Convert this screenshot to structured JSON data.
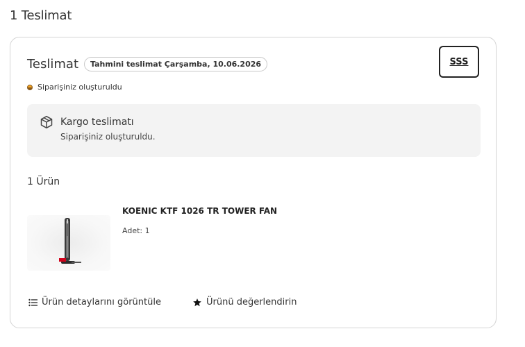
{
  "page": {
    "heading": "1 Teslimat"
  },
  "delivery": {
    "title": "Teslimat",
    "eta_badge": "Tahmini teslimat Çarşamba, 10.06.2026",
    "faq_label": "SSS",
    "status_text": "Siparişiniz oluşturuldu",
    "status_color": "#f5a623"
  },
  "shipping": {
    "icon": "package-icon",
    "title": "Kargo teslimatı",
    "subtitle": "Siparişiniz oluşturuldu."
  },
  "items": {
    "count_label": "1 Ürün",
    "products": [
      {
        "name": "KOENIC KTF 1026 TR TOWER FAN",
        "quantity": "Adet: 1"
      }
    ]
  },
  "actions": {
    "details_label": "Ürün detaylarını görüntüle",
    "details_icon": "list-icon",
    "rate_label": "Ürünü değerlendirin",
    "rate_icon": "star-icon"
  }
}
